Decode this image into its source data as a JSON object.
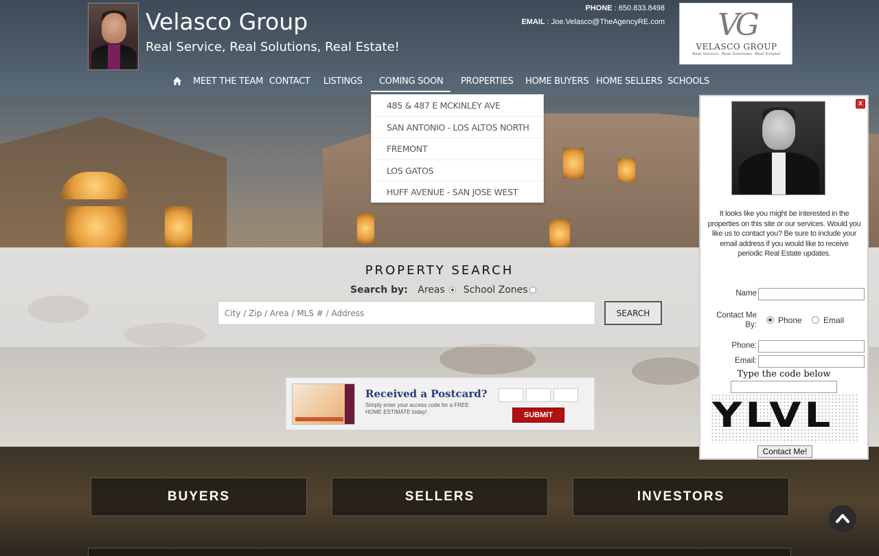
{
  "header": {
    "brand_title": "Velasco Group",
    "tagline": "Real Service, Real Solutions, Real Estate!",
    "phone_label": "PHONE",
    "phone": "650.833.8498",
    "email_label": "EMAIL",
    "email": "Joe.Velasco@TheAgencyRE.com",
    "logo_monogram": "VG",
    "logo_name": "VELASCO GROUP",
    "logo_sub": "Real Service. Real Solutions. Real Estate!"
  },
  "nav": {
    "items": [
      {
        "label": "MEET THE TEAM"
      },
      {
        "label": "CONTACT"
      },
      {
        "label": "LISTINGS"
      },
      {
        "label": "COMING SOON"
      },
      {
        "label": "PROPERTIES"
      },
      {
        "label": "HOME BUYERS"
      },
      {
        "label": "HOME SELLERS"
      },
      {
        "label": "SCHOOLS"
      }
    ],
    "active": "COMING SOON"
  },
  "dropdown": {
    "items": [
      "485 & 487 E MCKINLEY AVE",
      "SAN ANTONIO - LOS ALTOS NORTH",
      "FREMONT",
      "LOS GATOS",
      "HUFF AVENUE - SAN JOSE WEST"
    ]
  },
  "search": {
    "title": "PROPERTY SEARCH",
    "search_by": "Search by:",
    "option_areas": "Areas",
    "option_school_zones": "School Zones",
    "selected": "Areas",
    "placeholder": "City / Zip / Area / MLS # / Address",
    "button": "SEARCH"
  },
  "postcard": {
    "title": "Received a Postcard?",
    "description": "Simply enter your access code for a FREE HOME ESTIMATE today!",
    "submit": "SUBMIT"
  },
  "categories": [
    "BUYERS",
    "SELLERS",
    "INVESTORS"
  ],
  "popup": {
    "close": "x",
    "message": "It looks like you might be interested in the properties on this site or our services. Would you like us to contact you? Be sure to include your email address if you would like to receive periodic Real Estate updates.",
    "name_label": "Name",
    "contact_me_by_label": "Contact Me By:",
    "option_phone": "Phone",
    "option_email": "Email",
    "selected_method": "Phone",
    "phone_label": "Phone:",
    "email_label": "Email:",
    "captcha_label": "Type the code below",
    "captcha_text": "YLVL",
    "submit": "Contact Me!"
  },
  "colors": {
    "postcard_title": "#243d7a",
    "submit_red": "#b01111",
    "close_red": "#cf2b2b"
  },
  "icons": {
    "home": "home-icon",
    "scroll_top": "chevron-up-icon"
  }
}
